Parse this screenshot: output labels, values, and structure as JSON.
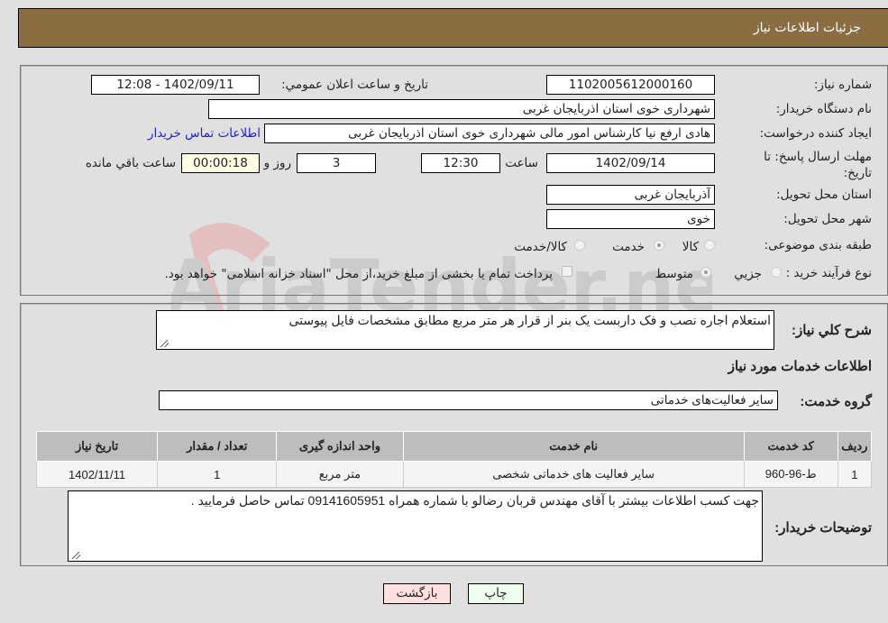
{
  "header": {
    "title": "جزئیات اطلاعات نیاز"
  },
  "form": {
    "need_number_label": "شماره نیاز:",
    "need_number": "1102005612000160",
    "announce_label": "تاریخ و ساعت اعلان عمومي:",
    "announce_value": "1402/09/11 - 12:08",
    "buyer_org_label": "نام دستگاه خریدار:",
    "buyer_org": "شهرداری خوی استان اذربایجان غربی",
    "requester_label": "ایجاد کننده درخواست:",
    "requester": "هادی ارفع نیا کارشناس امور مالی شهرداری خوی استان اذربایجان غربی",
    "contact_link": "اطلاعات تماس خریدار",
    "deadline_label": "مهلت ارسال پاسخ: تا تاریخ:",
    "deadline_date": "1402/09/14",
    "time_label": "ساعت",
    "deadline_time": "12:30",
    "days_value": "3",
    "days_label": "روز و",
    "remaining_time": "00:00:18",
    "remaining_label": "ساعت باقي مانده",
    "province_label": "استان محل تحویل:",
    "province": "آذربایجان غربی",
    "city_label": "شهر محل تحویل:",
    "city": "خوی",
    "category_label": "طبقه بندی موضوعی:",
    "category_options": [
      {
        "label": "کالا",
        "selected": false
      },
      {
        "label": "خدمت",
        "selected": true
      },
      {
        "label": "کالا/خدمت",
        "selected": false
      }
    ],
    "process_label": "نوع فرآیند خرید :",
    "process_options": [
      {
        "label": "جزيي",
        "selected": false
      },
      {
        "label": "متوسط",
        "selected": true
      }
    ],
    "treasury_checkbox_label": "پرداخت تمام یا بخشی از مبلغ خرید،از محل \"اسناد خزانه اسلامی\" خواهد بود.",
    "treasury_checked": false
  },
  "details": {
    "summary_label": "شرح کلي نیاز:",
    "summary": "استعلام اجاره نصب و فک داربست یک بنر از قرار هر متر مربع مطابق مشخصات فایل پیوستی",
    "services_heading": "اطلاعات خدمات مورد نیاز",
    "service_group_label": "گروه خدمت:",
    "service_group": "سایر فعالیت‌های خدماتی",
    "table": {
      "headers": [
        "ردیف",
        "کد خدمت",
        "نام خدمت",
        "واحد اندازه گیری",
        "تعداد / مقدار",
        "تاریخ نیاز"
      ],
      "rows": [
        [
          "1",
          "ط-96-960",
          "سایر فعالیت های خدماتی شخصی",
          "متر مربع",
          "1",
          "1402/11/11"
        ]
      ]
    },
    "buyer_notes_label": "توضیحات خریدار:",
    "buyer_notes": "جهت کسب اطلاعات بیشتر با آقای مهندس قربان رضالو با شماره همراه 09141605951 تماس حاصل فرمایید ."
  },
  "buttons": {
    "print": "چاپ",
    "back": "بازگشت"
  },
  "watermark": {
    "text": "AriaTender.neT"
  }
}
